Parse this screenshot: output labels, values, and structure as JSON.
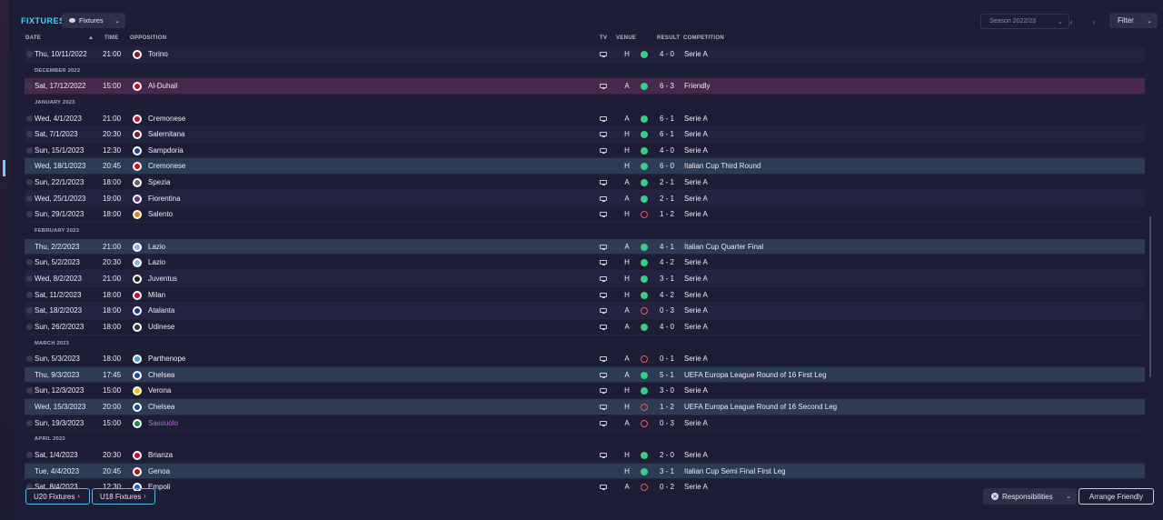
{
  "header": {
    "title": "FIXTURES",
    "view_label": "Fixtures",
    "season_label": "Season 2022/23",
    "filter_label": "Filter"
  },
  "columns": {
    "date": "DATE",
    "time": "TIME",
    "opposition": "OPPOSITION",
    "tv": "TV",
    "venue": "VENUE",
    "result": "RESULT",
    "competition": "COMPETITION"
  },
  "rows": [
    {
      "kind": "match",
      "date": "Thu, 10/11/2022",
      "time": "21:00",
      "opp": "Torino",
      "badge": "#8b1a1a",
      "tv": true,
      "venue": "H",
      "outcome": "win",
      "score": "4 - 0",
      "comp": "Serie A",
      "style": "alt"
    },
    {
      "kind": "month",
      "label": "DECEMBER 2022"
    },
    {
      "kind": "match",
      "date": "Sat, 17/12/2022",
      "time": "15:00",
      "opp": "Al-Duhail",
      "badge": "#c8102e",
      "tv": true,
      "venue": "A",
      "outcome": "win",
      "score": "6 - 3",
      "comp": "Friendly",
      "style": "hl-purple"
    },
    {
      "kind": "month",
      "label": "JANUARY 2023"
    },
    {
      "kind": "match",
      "date": "Wed, 4/1/2023",
      "time": "21:00",
      "opp": "Cremonese",
      "badge": "#c8102e",
      "tv": true,
      "venue": "A",
      "outcome": "win",
      "score": "6 - 1",
      "comp": "Serie A",
      "style": ""
    },
    {
      "kind": "match",
      "date": "Sat, 7/1/2023",
      "time": "20:30",
      "opp": "Salernitana",
      "badge": "#7a1a2e",
      "tv": true,
      "venue": "H",
      "outcome": "win",
      "score": "6 - 1",
      "comp": "Serie A",
      "style": "alt"
    },
    {
      "kind": "match",
      "date": "Sun, 15/1/2023",
      "time": "12:30",
      "opp": "Sampdoria",
      "badge": "#1b3f8f",
      "tv": true,
      "venue": "H",
      "outcome": "win",
      "score": "4 - 0",
      "comp": "Serie A",
      "style": ""
    },
    {
      "kind": "match",
      "date": "Wed, 18/1/2023",
      "time": "20:45",
      "opp": "Cremonese",
      "badge": "#c8102e",
      "tv": false,
      "venue": "H",
      "outcome": "win",
      "score": "6 - 0",
      "comp": "Italian Cup Third Round",
      "style": "hl-blue"
    },
    {
      "kind": "match",
      "date": "Sun, 22/1/2023",
      "time": "18:00",
      "opp": "Spezia",
      "badge": "#6b6b4a",
      "tv": true,
      "venue": "A",
      "outcome": "win",
      "score": "2 - 1",
      "comp": "Serie A",
      "style": ""
    },
    {
      "kind": "match",
      "date": "Wed, 25/1/2023",
      "time": "19:00",
      "opp": "Fiorentina",
      "badge": "#6a2c91",
      "tv": true,
      "venue": "A",
      "outcome": "win",
      "score": "2 - 1",
      "comp": "Serie A",
      "style": "alt"
    },
    {
      "kind": "match",
      "date": "Sun, 29/1/2023",
      "time": "18:00",
      "opp": "Salento",
      "badge": "#e08a14",
      "tv": true,
      "venue": "H",
      "outcome": "loss",
      "score": "1 - 2",
      "comp": "Serie A",
      "style": ""
    },
    {
      "kind": "month",
      "label": "FEBRUARY 2023"
    },
    {
      "kind": "match",
      "date": "Thu, 2/2/2023",
      "time": "21:00",
      "opp": "Lazio",
      "badge": "#87b6de",
      "tv": true,
      "venue": "A",
      "outcome": "win",
      "score": "4 - 1",
      "comp": "Italian Cup Quarter Final",
      "style": "hl-blue"
    },
    {
      "kind": "match",
      "date": "Sun, 5/2/2023",
      "time": "20:30",
      "opp": "Lazio",
      "badge": "#87b6de",
      "tv": true,
      "venue": "H",
      "outcome": "win",
      "score": "4 - 2",
      "comp": "Serie A",
      "style": ""
    },
    {
      "kind": "match",
      "date": "Wed, 8/2/2023",
      "time": "21:00",
      "opp": "Juventus",
      "badge": "#222222",
      "tv": true,
      "venue": "H",
      "outcome": "win",
      "score": "3 - 1",
      "comp": "Serie A",
      "style": "alt"
    },
    {
      "kind": "match",
      "date": "Sat, 11/2/2023",
      "time": "18:00",
      "opp": "Milan",
      "badge": "#c8102e",
      "tv": true,
      "venue": "H",
      "outcome": "win",
      "score": "4 - 2",
      "comp": "Serie A",
      "style": ""
    },
    {
      "kind": "match",
      "date": "Sat, 18/2/2023",
      "time": "18:00",
      "opp": "Atalanta",
      "badge": "#1c3e8a",
      "tv": true,
      "venue": "A",
      "outcome": "loss",
      "score": "0 - 3",
      "comp": "Serie A",
      "style": "alt"
    },
    {
      "kind": "match",
      "date": "Sun, 26/2/2023",
      "time": "18:00",
      "opp": "Udinese",
      "badge": "#333333",
      "tv": true,
      "venue": "A",
      "outcome": "win",
      "score": "4 - 0",
      "comp": "Serie A",
      "style": ""
    },
    {
      "kind": "month",
      "label": "MARCH 2023"
    },
    {
      "kind": "match",
      "date": "Sun, 5/3/2023",
      "time": "18:00",
      "opp": "Parthenope",
      "badge": "#3f9be0",
      "tv": true,
      "venue": "A",
      "outcome": "loss",
      "score": "0 - 1",
      "comp": "Serie A",
      "style": ""
    },
    {
      "kind": "match",
      "date": "Thu, 9/3/2023",
      "time": "17:45",
      "opp": "Chelsea",
      "badge": "#1a4aa8",
      "tv": true,
      "venue": "A",
      "outcome": "win",
      "score": "5 - 1",
      "comp": "UEFA Europa League Round of 16  First Leg",
      "style": "hl-blue"
    },
    {
      "kind": "match",
      "date": "Sun, 12/3/2023",
      "time": "15:00",
      "opp": "Verona",
      "badge": "#f2c200",
      "tv": true,
      "venue": "H",
      "outcome": "win",
      "score": "3 - 0",
      "comp": "Serie A",
      "style": ""
    },
    {
      "kind": "match",
      "date": "Wed, 15/3/2023",
      "time": "20:00",
      "opp": "Chelsea",
      "badge": "#1a4aa8",
      "tv": true,
      "venue": "H",
      "outcome": "loss",
      "score": "1 - 2",
      "comp": "UEFA Europa League Round of 16  Second Leg",
      "style": "hl-blue"
    },
    {
      "kind": "match",
      "date": "Sun, 19/3/2023",
      "time": "15:00",
      "opp": "Sassuolo",
      "badge": "#1f8a3a",
      "tv": true,
      "venue": "A",
      "outcome": "loss",
      "score": "0 - 3",
      "comp": "Serie A",
      "style": "",
      "opp_class": "sassuolo"
    },
    {
      "kind": "month",
      "label": "APRIL 2023"
    },
    {
      "kind": "match",
      "date": "Sat, 1/4/2023",
      "time": "20:30",
      "opp": "Brianza",
      "badge": "#c8102e",
      "tv": true,
      "venue": "H",
      "outcome": "win",
      "score": "2 - 0",
      "comp": "Serie A",
      "style": ""
    },
    {
      "kind": "match",
      "date": "Tue, 4/4/2023",
      "time": "20:45",
      "opp": "Genoa",
      "badge": "#b5121b",
      "tv": false,
      "venue": "H",
      "outcome": "win",
      "score": "3 - 1",
      "comp": "Italian Cup Semi Final First Leg",
      "style": "hl-blue"
    },
    {
      "kind": "match",
      "date": "Sat, 8/4/2023",
      "time": "12:30",
      "opp": "Empoli",
      "badge": "#1f5fb8",
      "tv": true,
      "venue": "A",
      "outcome": "loss",
      "score": "0 - 2",
      "comp": "Serie A",
      "style": ""
    }
  ],
  "footer": {
    "u20_label": "U20 Fixtures",
    "u18_label": "U18 Fixtures",
    "responsibilities_label": "Responsibilities",
    "arrange_label": "Arrange Friendly"
  }
}
